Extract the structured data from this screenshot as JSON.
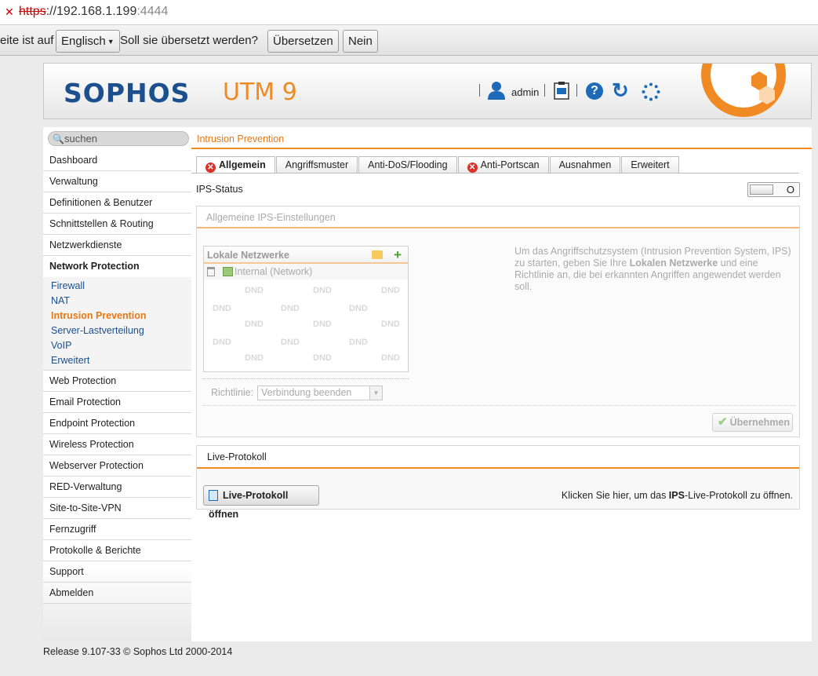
{
  "browser": {
    "url_protocol": "https",
    "url_sep": "://",
    "url_host": "192.168.1.199",
    "url_port": ":4444"
  },
  "translate": {
    "prefix": "eite ist auf",
    "language": "Englisch",
    "question": "Soll sie übersetzt werden?",
    "translate_btn": "Übersetzen",
    "no_btn": "Nein"
  },
  "header": {
    "logo": "SOPHOS",
    "product": "UTM 9",
    "user": "admin",
    "colors": {
      "brand_blue": "#1c4f8e",
      "accent_orange": "#f08a24"
    }
  },
  "sidebar": {
    "search_placeholder": "suchen",
    "items": [
      "Dashboard",
      "Verwaltung",
      "Definitionen & Benutzer",
      "Schnittstellen & Routing",
      "Netzwerkdienste"
    ],
    "group": "Network Protection",
    "subitems": [
      "Firewall",
      "NAT",
      "Intrusion Prevention",
      "Server-Lastverteilung",
      "VoIP",
      "Erweitert"
    ],
    "items_after": [
      "Web Protection",
      "Email Protection",
      "Endpoint Protection",
      "Wireless Protection",
      "Webserver Protection",
      "RED-Verwaltung",
      "Site-to-Site-VPN",
      "Fernzugriff",
      "Protokolle & Berichte",
      "Support",
      "Abmelden"
    ]
  },
  "content": {
    "breadcrumb": "Intrusion Prevention",
    "tabs": [
      "Allgemein",
      "Angriffsmuster",
      "Anti-DoS/Flooding",
      "Anti-Portscan",
      "Ausnahmen",
      "Erweitert"
    ],
    "ips_status_label": "IPS-Status",
    "toggle_state": "O",
    "settings_title": "Allgemeine IPS-Einstellungen",
    "networks_title": "Lokale Netzwerke",
    "network_entry": "Internal (Network)",
    "dnd": "DND",
    "policy_label": "Richtlinie:",
    "policy_value": "Verbindung beenden",
    "desc_1": "Um das Angriffschutzsystem (Intrusion Prevention System, IPS) zu starten, geben Sie Ihre ",
    "desc_bold": "Lokalen Netzwerke",
    "desc_2": " und eine Richtlinie an, die bei erkannten Angriffen angewendet werden soll.",
    "apply_btn": "Übernehmen",
    "live_title": "Live-Protokoll",
    "live_btn": "Live-Protokoll öffnen",
    "live_hint_1": "Klicken Sie hier, um das ",
    "live_hint_bold": "IPS",
    "live_hint_2": "-Live-Protokoll zu öffnen."
  },
  "footer": "Release 9.107-33 © Sophos Ltd 2000-2014"
}
